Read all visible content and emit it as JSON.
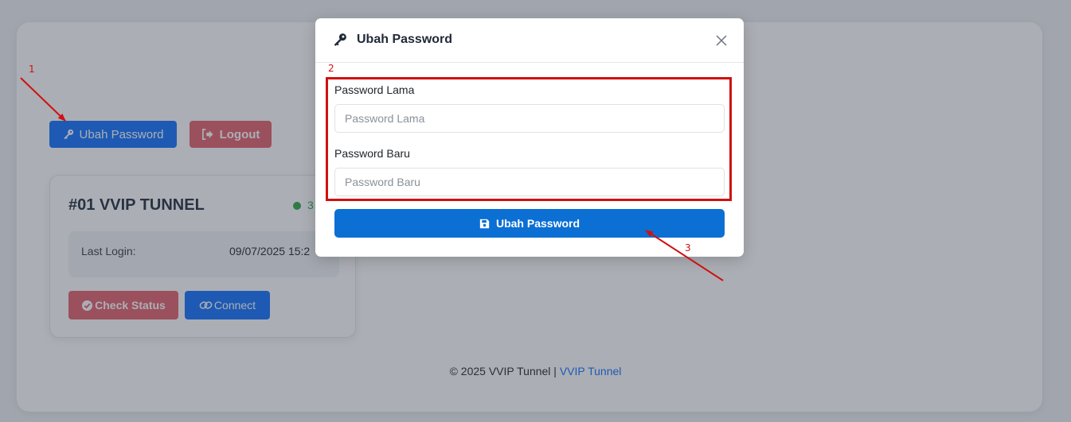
{
  "toolbar": {
    "ubah_password_label": "Ubah Password",
    "logout_label": "Logout"
  },
  "tunnel_card": {
    "title": "#01 VVIP TUNNEL",
    "status_text": "3",
    "last_login_label": "Last Login:",
    "last_login_value": "09/07/2025 15:2",
    "check_status_label": "Check Status",
    "connect_label": "Connect"
  },
  "footer": {
    "copyright": "© 2025 VVIP Tunnel |",
    "link_text": "VVIP Tunnel"
  },
  "modal": {
    "title": "Ubah Password",
    "old_password_label": "Password Lama",
    "old_password_placeholder": "Password Lama",
    "new_password_label": "Password Baru",
    "new_password_placeholder": "Password Baru",
    "submit_label": "Ubah Password"
  },
  "annotations": {
    "step1": "1",
    "step2": "2",
    "step3": "3"
  },
  "colors": {
    "primary": "#0d6efd",
    "danger": "#e35d6a",
    "success": "#28a745",
    "annotation": "#d01010"
  },
  "icons": [
    "key-icon",
    "logout-icon",
    "check-circle-icon",
    "link-icon",
    "close-icon",
    "save-icon"
  ]
}
